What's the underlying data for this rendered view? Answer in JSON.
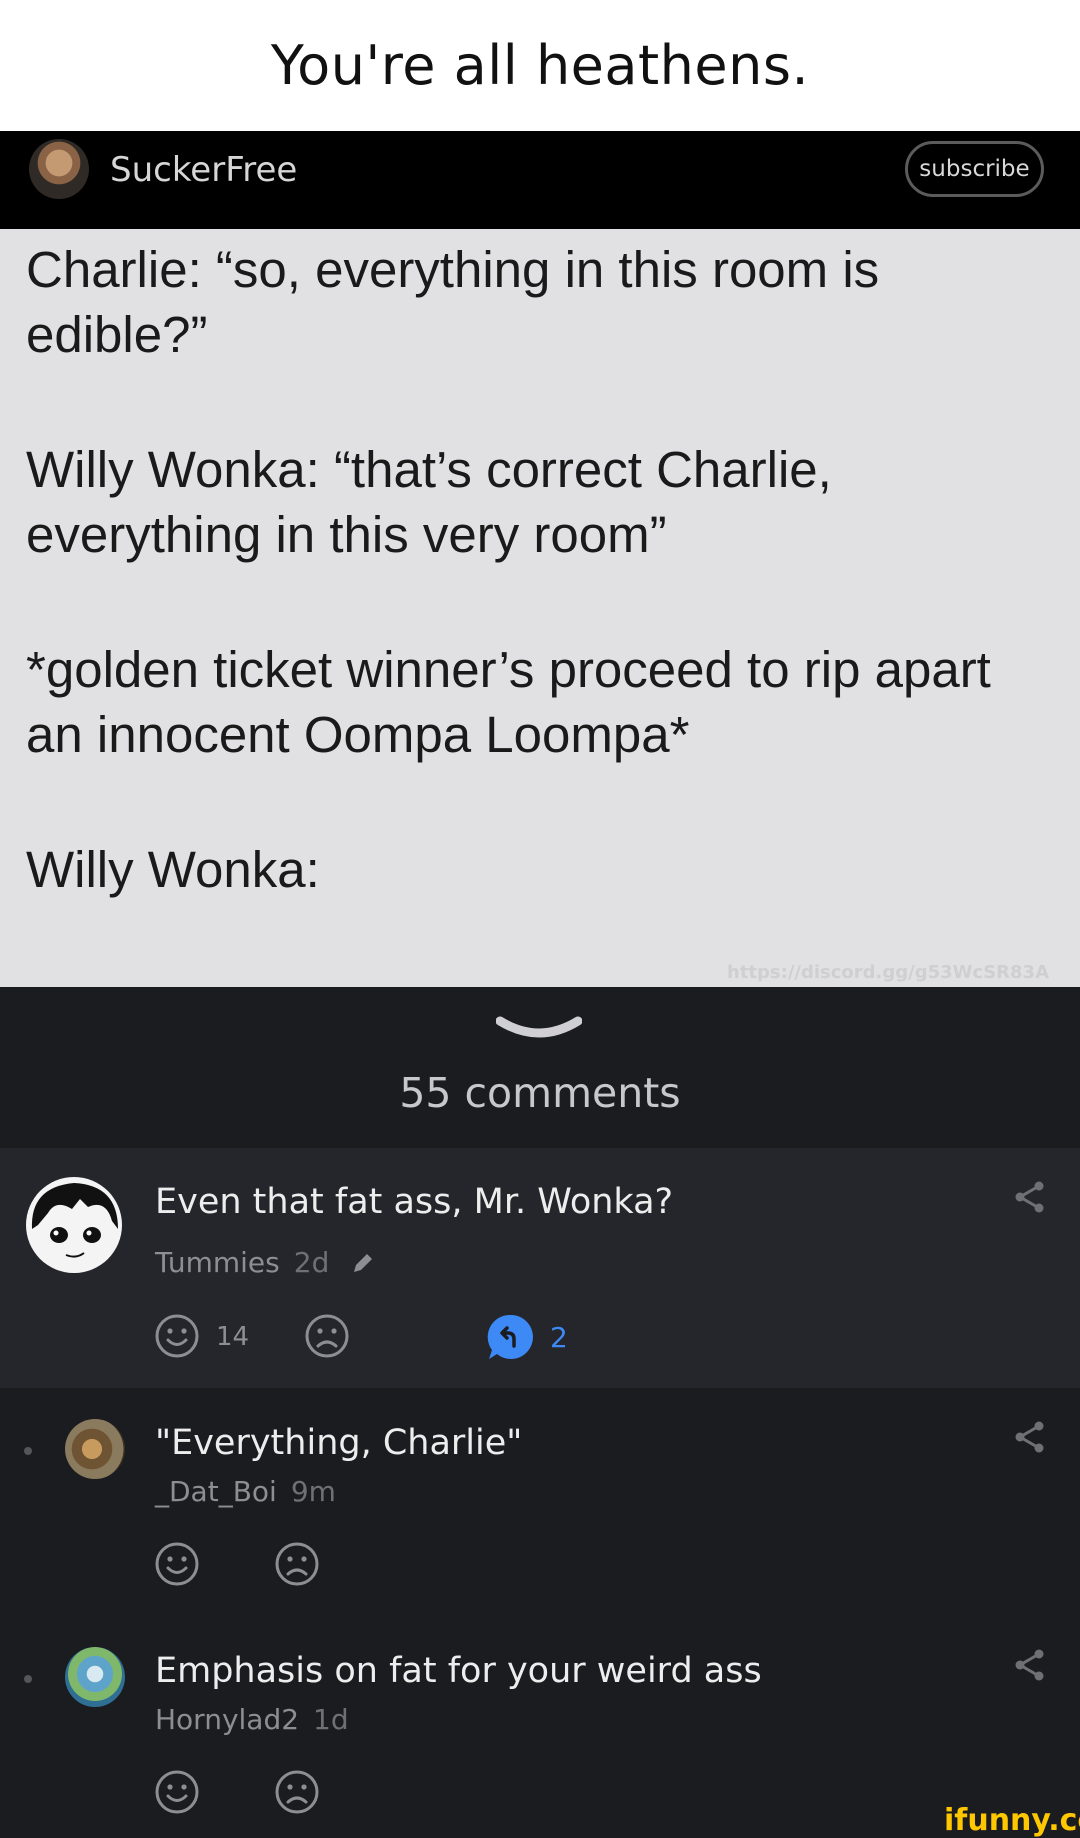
{
  "title": "You're all heathens.",
  "author": {
    "name": "SuckerFree",
    "subscribe_label": "subscribe"
  },
  "post": {
    "paragraphs": [
      "Charlie: “so, everything in this room is edible?”",
      "Willy Wonka: “that’s correct Charlie, everything in this very room”",
      "*golden ticket winner’s proceed to rip apart an innocent Oompa Loompa*",
      "Willy Wonka:"
    ],
    "watermark": "https://discord.gg/g53WcSR83A"
  },
  "comments_count_label": "55 comments",
  "comments": [
    {
      "text": "Even that fat ass, Mr. Wonka?",
      "user": "Tummies",
      "time": "2d",
      "likes": "14",
      "replies": "2"
    },
    {
      "text": "\"Everything, Charlie\"",
      "user": "_Dat_Boi",
      "time": "9m"
    },
    {
      "text": "Emphasis on fat for your weird ass",
      "user": "Hornylad2",
      "time": "1d"
    }
  ],
  "logo_text": "ifunny.co",
  "colors": {
    "accent_blue": "#3d8af7",
    "logo_yellow": "#ffc700",
    "background": "#1b1c20"
  }
}
